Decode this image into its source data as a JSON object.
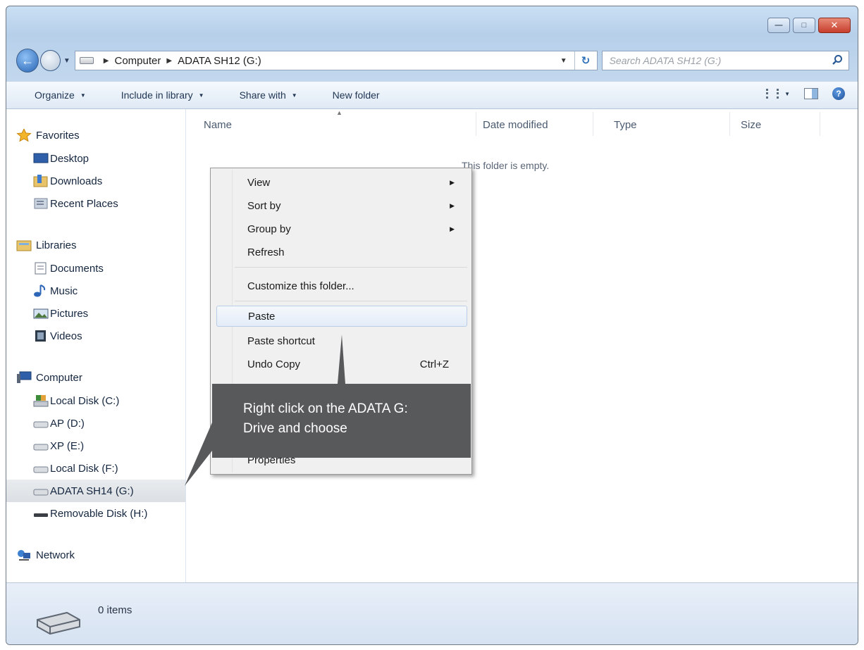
{
  "address_bar": {
    "crumbs": [
      "Computer",
      "ADATA SH12 (G:)"
    ]
  },
  "search": {
    "placeholder": "Search ADATA SH12 (G:)"
  },
  "toolbar": {
    "organize": "Organize",
    "include_in_library": "Include in library",
    "share_with": "Share with",
    "new_folder": "New folder"
  },
  "nav_pane": {
    "favorites": {
      "label": "Favorites",
      "items": [
        "Desktop",
        "Downloads",
        "Recent Places"
      ]
    },
    "libraries": {
      "label": "Libraries",
      "items": [
        "Documents",
        "Music",
        "Pictures",
        "Videos"
      ]
    },
    "computer": {
      "label": "Computer",
      "items": [
        "Local Disk (C:)",
        "AP (D:)",
        "XP (E:)",
        "Local Disk (F:)",
        "ADATA SH14 (G:)",
        "Removable Disk (H:)"
      ],
      "selected": "ADATA SH14 (G:)"
    },
    "network": {
      "label": "Network"
    }
  },
  "columns": [
    "Name",
    "Date modified",
    "Type",
    "Size"
  ],
  "empty_message": "This folder is empty.",
  "context_menu": {
    "items": [
      {
        "label": "View",
        "submenu": true
      },
      {
        "label": "Sort by",
        "submenu": true
      },
      {
        "label": "Group by",
        "submenu": true
      },
      {
        "label": "Refresh"
      },
      {
        "label": "Customize this folder..."
      },
      {
        "label": "Paste",
        "highlighted": true
      },
      {
        "label": "Paste shortcut"
      },
      {
        "label": "Undo Copy",
        "shortcut": "Ctrl+Z"
      },
      {
        "label": "Properties"
      }
    ]
  },
  "callout": {
    "line1": "Right click on the ADATA G:",
    "line2": "Drive and choose"
  },
  "status_bar": {
    "item_count": "0 items"
  },
  "colors": {
    "callout_bg": "#58595b",
    "window_frame": "#c3d8ee",
    "close_button": "#c73e2c"
  }
}
